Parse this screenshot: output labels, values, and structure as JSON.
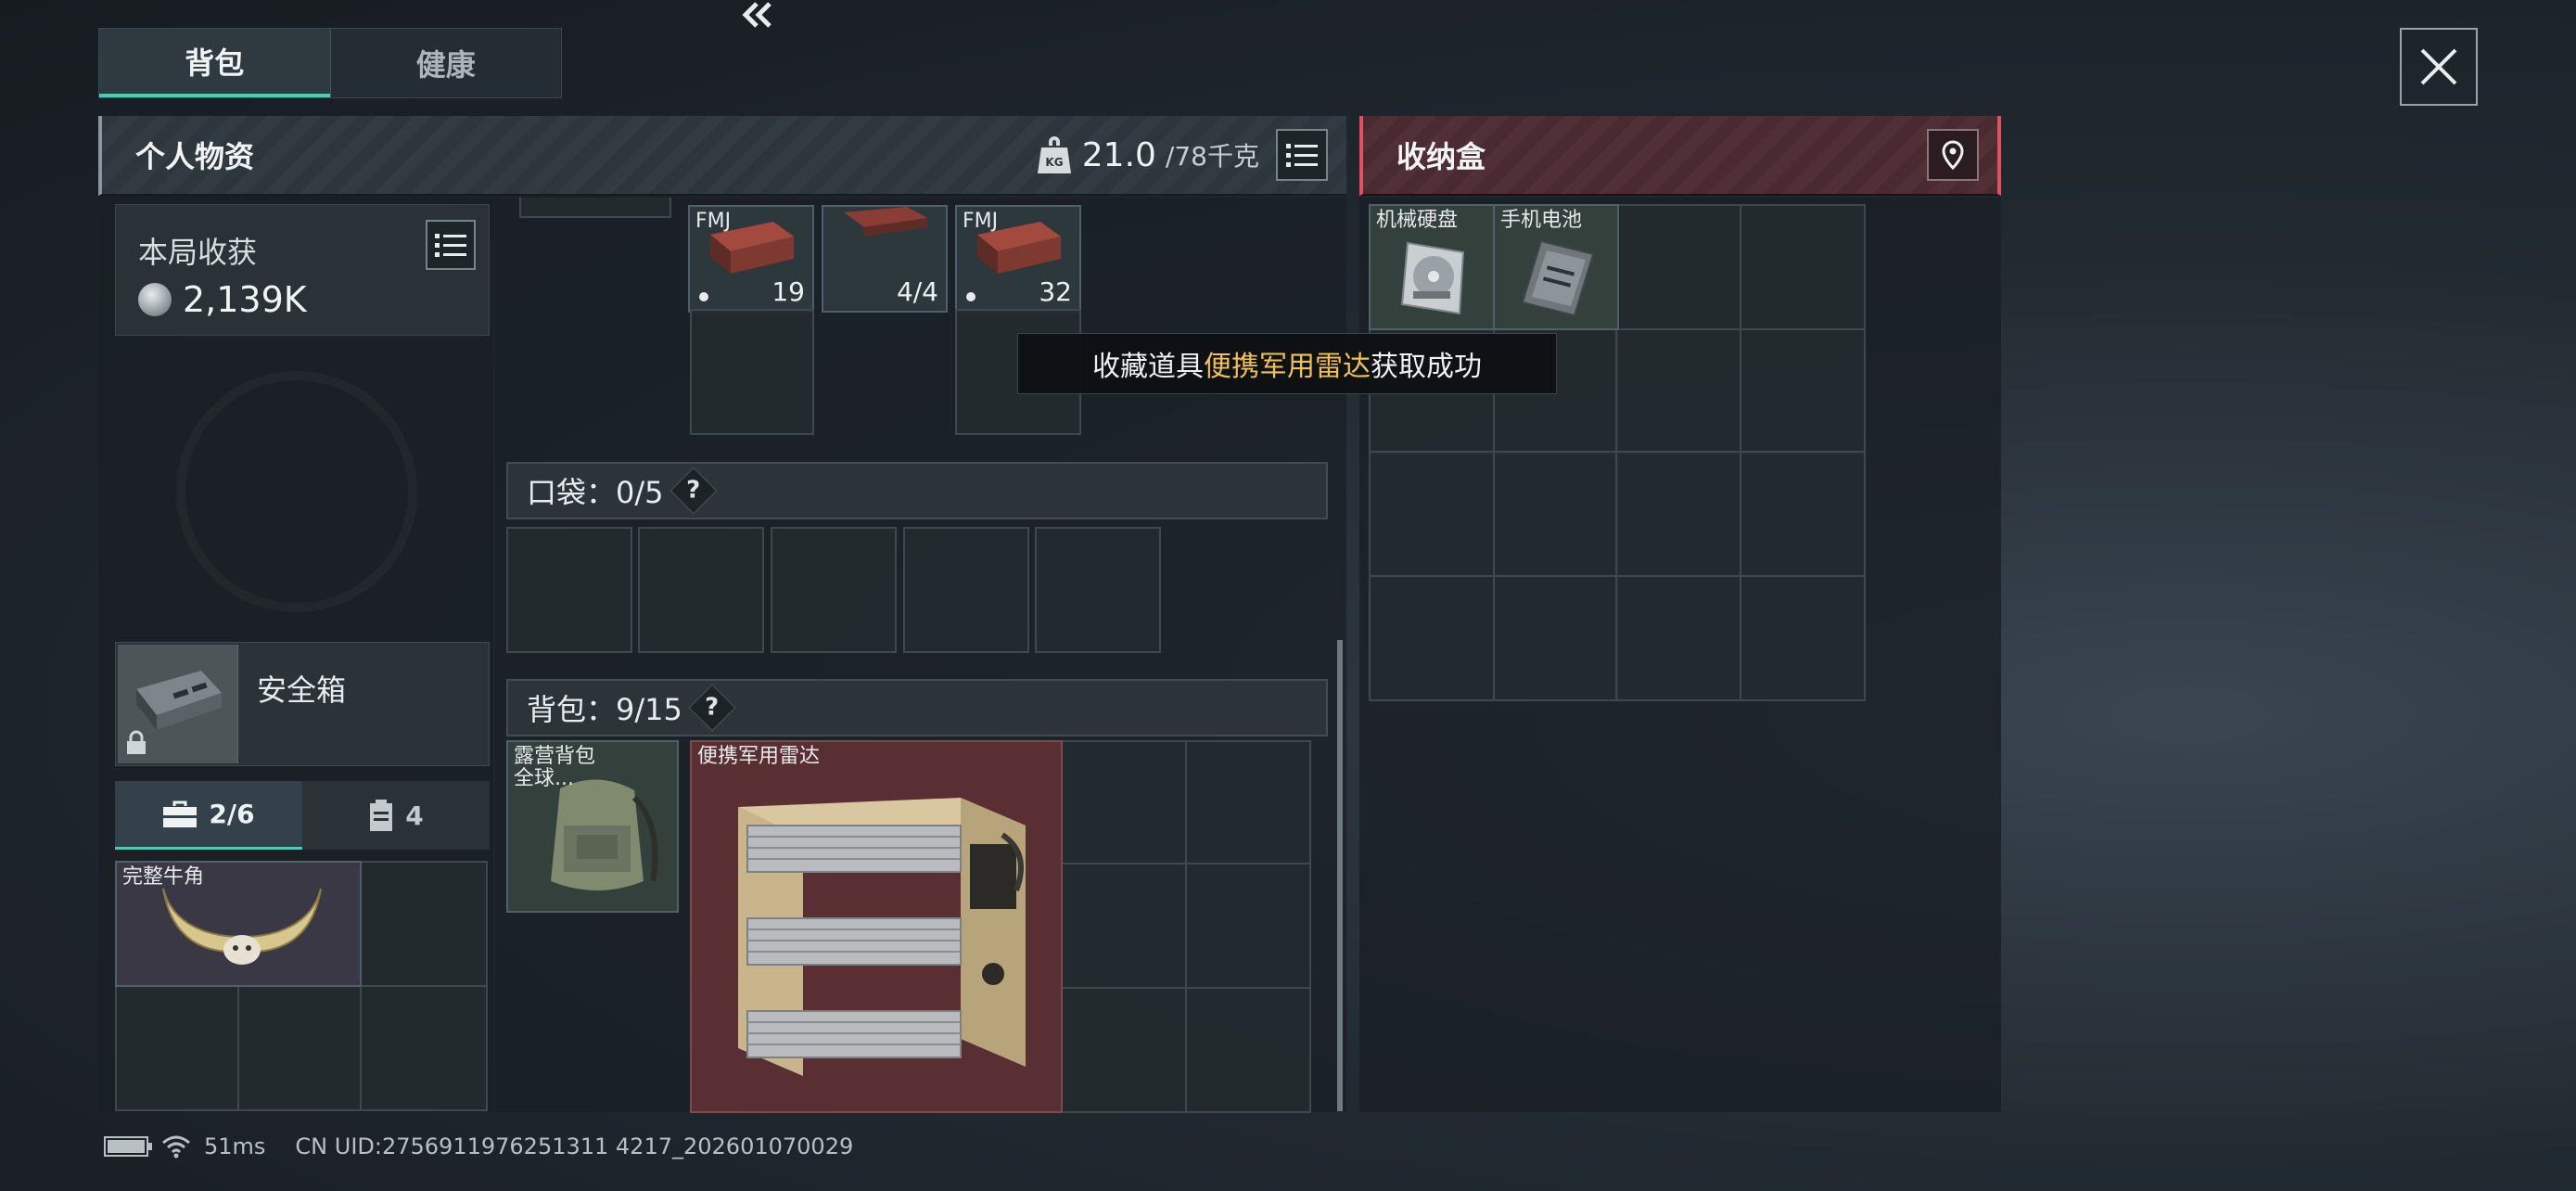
{
  "tabs": [
    {
      "label": "背包",
      "active": true
    },
    {
      "label": "健康",
      "active": false
    }
  ],
  "personal": {
    "title": "个人物资",
    "weight_current": "21.0",
    "weight_max": "/78千克"
  },
  "storage_box": {
    "title": "收纳盒",
    "items": [
      {
        "name": "机械硬盘"
      },
      {
        "name": "手机电池"
      }
    ]
  },
  "harvest": {
    "label": "本局收获",
    "value": "2,139K"
  },
  "safebox": {
    "label": "安全箱",
    "locked": true
  },
  "subtabs": [
    {
      "value": "2/6",
      "icon": "toolbox-icon",
      "active": true
    },
    {
      "value": "4",
      "icon": "clipboard-icon",
      "active": false
    }
  ],
  "rig_items": [
    {
      "name": "FMJ",
      "count": "19"
    },
    {
      "name": "",
      "count": "4/4"
    },
    {
      "name": "FMJ",
      "count": "32"
    }
  ],
  "pocket": {
    "label": "口袋：0/5",
    "help": "?"
  },
  "backpack": {
    "label": "背包：9/15",
    "help": "?",
    "items": [
      {
        "name_line1": "露营背包",
        "name_line2": "全球..."
      },
      {
        "name": "便携军用雷达"
      }
    ]
  },
  "safe_items": [
    {
      "name": "完整牛角"
    }
  ],
  "toast": {
    "prefix": "收藏道具",
    "highlight": "便携军用雷达",
    "suffix": "获取成功"
  },
  "status_bar": {
    "ping": "51ms",
    "uid": "CN UID:2756911976251311 4217_202601070029"
  },
  "colors": {
    "accent": "#3fd1b4",
    "storage_red": "#e0525f",
    "highlight_gold": "#f2c24e",
    "item_red_bg": "#5a2f33"
  }
}
